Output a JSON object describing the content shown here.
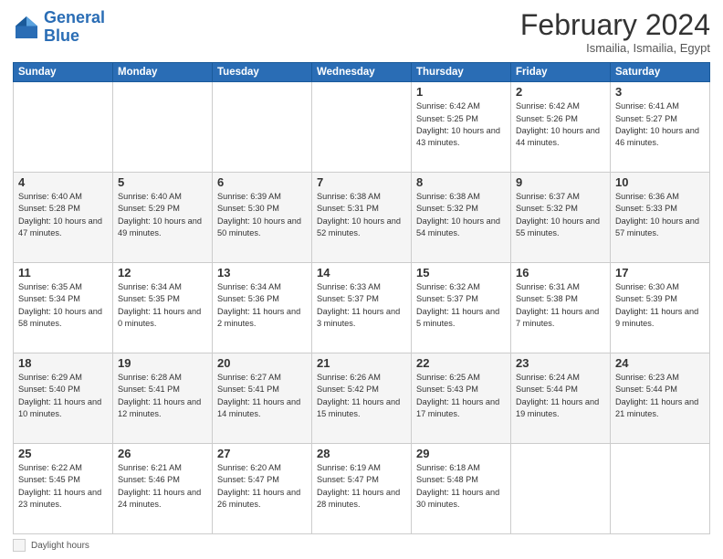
{
  "header": {
    "logo_general": "General",
    "logo_blue": "Blue",
    "month": "February 2024",
    "location": "Ismailia, Ismailia, Egypt"
  },
  "weekdays": [
    "Sunday",
    "Monday",
    "Tuesday",
    "Wednesday",
    "Thursday",
    "Friday",
    "Saturday"
  ],
  "legend": {
    "label": "Daylight hours"
  },
  "weeks": [
    [
      {
        "day": "",
        "info": ""
      },
      {
        "day": "",
        "info": ""
      },
      {
        "day": "",
        "info": ""
      },
      {
        "day": "",
        "info": ""
      },
      {
        "day": "1",
        "info": "Sunrise: 6:42 AM\nSunset: 5:25 PM\nDaylight: 10 hours\nand 43 minutes."
      },
      {
        "day": "2",
        "info": "Sunrise: 6:42 AM\nSunset: 5:26 PM\nDaylight: 10 hours\nand 44 minutes."
      },
      {
        "day": "3",
        "info": "Sunrise: 6:41 AM\nSunset: 5:27 PM\nDaylight: 10 hours\nand 46 minutes."
      }
    ],
    [
      {
        "day": "4",
        "info": "Sunrise: 6:40 AM\nSunset: 5:28 PM\nDaylight: 10 hours\nand 47 minutes."
      },
      {
        "day": "5",
        "info": "Sunrise: 6:40 AM\nSunset: 5:29 PM\nDaylight: 10 hours\nand 49 minutes."
      },
      {
        "day": "6",
        "info": "Sunrise: 6:39 AM\nSunset: 5:30 PM\nDaylight: 10 hours\nand 50 minutes."
      },
      {
        "day": "7",
        "info": "Sunrise: 6:38 AM\nSunset: 5:31 PM\nDaylight: 10 hours\nand 52 minutes."
      },
      {
        "day": "8",
        "info": "Sunrise: 6:38 AM\nSunset: 5:32 PM\nDaylight: 10 hours\nand 54 minutes."
      },
      {
        "day": "9",
        "info": "Sunrise: 6:37 AM\nSunset: 5:32 PM\nDaylight: 10 hours\nand 55 minutes."
      },
      {
        "day": "10",
        "info": "Sunrise: 6:36 AM\nSunset: 5:33 PM\nDaylight: 10 hours\nand 57 minutes."
      }
    ],
    [
      {
        "day": "11",
        "info": "Sunrise: 6:35 AM\nSunset: 5:34 PM\nDaylight: 10 hours\nand 58 minutes."
      },
      {
        "day": "12",
        "info": "Sunrise: 6:34 AM\nSunset: 5:35 PM\nDaylight: 11 hours\nand 0 minutes."
      },
      {
        "day": "13",
        "info": "Sunrise: 6:34 AM\nSunset: 5:36 PM\nDaylight: 11 hours\nand 2 minutes."
      },
      {
        "day": "14",
        "info": "Sunrise: 6:33 AM\nSunset: 5:37 PM\nDaylight: 11 hours\nand 3 minutes."
      },
      {
        "day": "15",
        "info": "Sunrise: 6:32 AM\nSunset: 5:37 PM\nDaylight: 11 hours\nand 5 minutes."
      },
      {
        "day": "16",
        "info": "Sunrise: 6:31 AM\nSunset: 5:38 PM\nDaylight: 11 hours\nand 7 minutes."
      },
      {
        "day": "17",
        "info": "Sunrise: 6:30 AM\nSunset: 5:39 PM\nDaylight: 11 hours\nand 9 minutes."
      }
    ],
    [
      {
        "day": "18",
        "info": "Sunrise: 6:29 AM\nSunset: 5:40 PM\nDaylight: 11 hours\nand 10 minutes."
      },
      {
        "day": "19",
        "info": "Sunrise: 6:28 AM\nSunset: 5:41 PM\nDaylight: 11 hours\nand 12 minutes."
      },
      {
        "day": "20",
        "info": "Sunrise: 6:27 AM\nSunset: 5:41 PM\nDaylight: 11 hours\nand 14 minutes."
      },
      {
        "day": "21",
        "info": "Sunrise: 6:26 AM\nSunset: 5:42 PM\nDaylight: 11 hours\nand 15 minutes."
      },
      {
        "day": "22",
        "info": "Sunrise: 6:25 AM\nSunset: 5:43 PM\nDaylight: 11 hours\nand 17 minutes."
      },
      {
        "day": "23",
        "info": "Sunrise: 6:24 AM\nSunset: 5:44 PM\nDaylight: 11 hours\nand 19 minutes."
      },
      {
        "day": "24",
        "info": "Sunrise: 6:23 AM\nSunset: 5:44 PM\nDaylight: 11 hours\nand 21 minutes."
      }
    ],
    [
      {
        "day": "25",
        "info": "Sunrise: 6:22 AM\nSunset: 5:45 PM\nDaylight: 11 hours\nand 23 minutes."
      },
      {
        "day": "26",
        "info": "Sunrise: 6:21 AM\nSunset: 5:46 PM\nDaylight: 11 hours\nand 24 minutes."
      },
      {
        "day": "27",
        "info": "Sunrise: 6:20 AM\nSunset: 5:47 PM\nDaylight: 11 hours\nand 26 minutes."
      },
      {
        "day": "28",
        "info": "Sunrise: 6:19 AM\nSunset: 5:47 PM\nDaylight: 11 hours\nand 28 minutes."
      },
      {
        "day": "29",
        "info": "Sunrise: 6:18 AM\nSunset: 5:48 PM\nDaylight: 11 hours\nand 30 minutes."
      },
      {
        "day": "",
        "info": ""
      },
      {
        "day": "",
        "info": ""
      }
    ]
  ]
}
